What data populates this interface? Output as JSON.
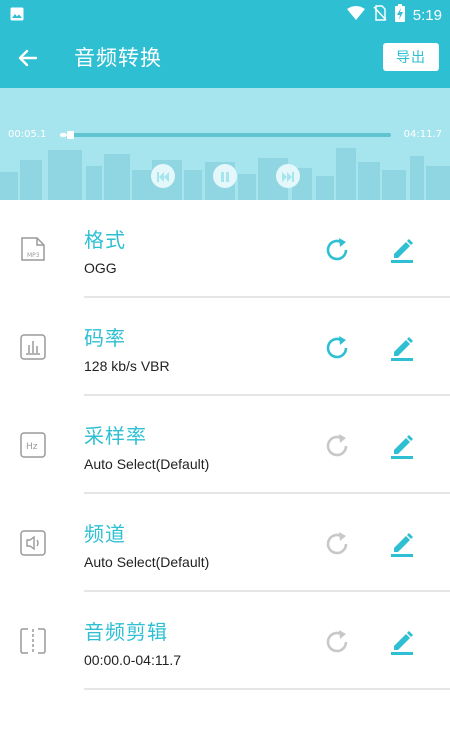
{
  "status_bar": {
    "time": "5:19"
  },
  "app_bar": {
    "title": "音频转换",
    "export_label": "导出"
  },
  "player": {
    "current_time": "00:05.1",
    "total_time": "04:11.7",
    "progress": 0.02
  },
  "settings": [
    {
      "label": "格式",
      "value": "OGG",
      "icon": "mp3-file-icon",
      "reset_active": true
    },
    {
      "label": "码率",
      "value": "128 kb/s VBR",
      "icon": "bitrate-icon",
      "reset_active": true
    },
    {
      "label": "采样率",
      "value": "Auto Select(Default)",
      "icon": "hz-icon",
      "reset_active": false
    },
    {
      "label": "频道",
      "value": "Auto Select(Default)",
      "icon": "speaker-icon",
      "reset_active": false
    },
    {
      "label": "音频剪辑",
      "value": "00:00.0-04:11.7",
      "icon": "trim-icon",
      "reset_active": false
    }
  ],
  "colors": {
    "accent": "#2fbfd3",
    "player_bg": "#a6e4ee",
    "inactive": "#c8c8c8",
    "text": "#222222"
  }
}
